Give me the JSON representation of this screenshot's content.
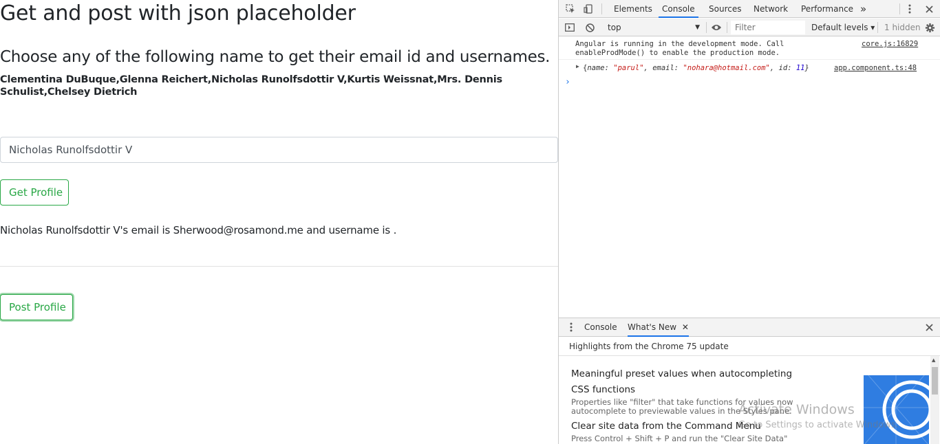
{
  "app": {
    "title": "Get and post with json placeholder",
    "subtitle": "Choose any of the following name to get their email id and usernames.",
    "names": "Clementina DuBuque,Glenna Reichert,Nicholas Runolfsdottir V,Kurtis Weissnat,Mrs. Dennis Schulist,Chelsey Dietrich",
    "name_input_value": "Nicholas Runolfsdottir V",
    "get_button": "Get Profile",
    "result": "Nicholas Runolfsdottir V's email is Sherwood@rosamond.me and username is .",
    "post_button": "Post Profile"
  },
  "devtools": {
    "tabs": [
      "Elements",
      "Console",
      "Sources",
      "Network",
      "Performance"
    ],
    "active_tab": "Console",
    "more_tabs": "»",
    "context": "top",
    "filter_placeholder": "Filter",
    "levels": "Default levels ▾",
    "hidden": "1 hidden",
    "messages": [
      {
        "text": "Angular is running in the development mode. Call\nenableProdMode() to enable the production mode.",
        "source": "core.js:16829"
      },
      {
        "object": {
          "prefix": "{",
          "k_name": "name: ",
          "v_name": "\"parul\"",
          "sep1": ", ",
          "k_email": "email: ",
          "v_email": "\"nohara@hotmail.com\"",
          "sep2": ", ",
          "k_id": "id: ",
          "v_id": "11",
          "suffix": "}"
        },
        "source": "app.component.ts:48"
      }
    ],
    "prompt": "›",
    "drawer": {
      "tabs": [
        "Console",
        "What's New"
      ],
      "active_tab": "What's New",
      "highlights": "Highlights from the Chrome 75 update",
      "items": [
        {
          "title": "Meaningful preset values when autocompleting CSS functions",
          "desc": "Properties like \"filter\" that take functions for values now autocomplete to previewable values in the Styles pane."
        },
        {
          "title": "Clear site data from the Command Menu",
          "desc": "Press Control + Shift + P and run the \"Clear Site Data\" command"
        }
      ]
    }
  },
  "watermark": {
    "line1": "Activate Windows",
    "line2": "Go to Settings to activate Windows."
  },
  "colors": {
    "success": "#28a745",
    "devtools_blue": "#1a73e8",
    "string_red": "#c41a16",
    "number_blue": "#1c00cf"
  }
}
